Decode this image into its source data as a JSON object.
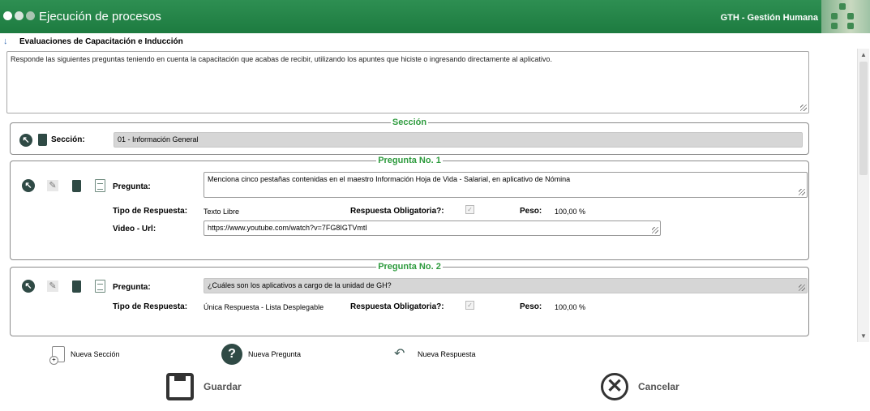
{
  "header": {
    "title": "Ejecución de procesos",
    "brand": "GTH - Gestión Humana",
    "colors": {
      "bar": "#1d7b40",
      "legend": "#2e9b3e"
    }
  },
  "page": {
    "subtitle": "Evaluaciones de Capacitación e Inducción",
    "instructions": "Responde las siguientes preguntas teniendo en cuenta la capacitación que acabas de recibir, utilizando los apuntes que hiciste o ingresando directamente al aplicativo."
  },
  "section": {
    "legend": "Sección",
    "label": "Sección:",
    "value": "01 - Información General"
  },
  "questions": [
    {
      "legend": "Pregunta No. 1",
      "question_label": "Pregunta:",
      "question_value": "Menciona cinco pestañas contenidas en el maestro Información Hoja de Vida - Salarial, en aplicativo de Nómina",
      "type_label": "Tipo de Respuesta:",
      "type_value": "Texto Libre",
      "required_label": "Respuesta Obligatoria?:",
      "weight_label": "Peso:",
      "weight_value": "100,00 %",
      "video_label": "Video - Url:",
      "video_value": "https://www.youtube.com/watch?v=7FG8IGTVmtI"
    },
    {
      "legend": "Pregunta No. 2",
      "question_label": "Pregunta:",
      "question_value": "¿Cuáles son los aplicativos a cargo de la unidad de GH?",
      "type_label": "Tipo de Respuesta:",
      "type_value": "Única Respuesta - Lista Desplegable",
      "required_label": "Respuesta Obligatoria?:",
      "weight_label": "Peso:",
      "weight_value": "100,00 %"
    }
  ],
  "actions": {
    "new_section": "Nueva Sección",
    "new_question": "Nueva Pregunta",
    "new_answer": "Nueva Respuesta",
    "save": "Guardar",
    "cancel": "Cancelar"
  }
}
